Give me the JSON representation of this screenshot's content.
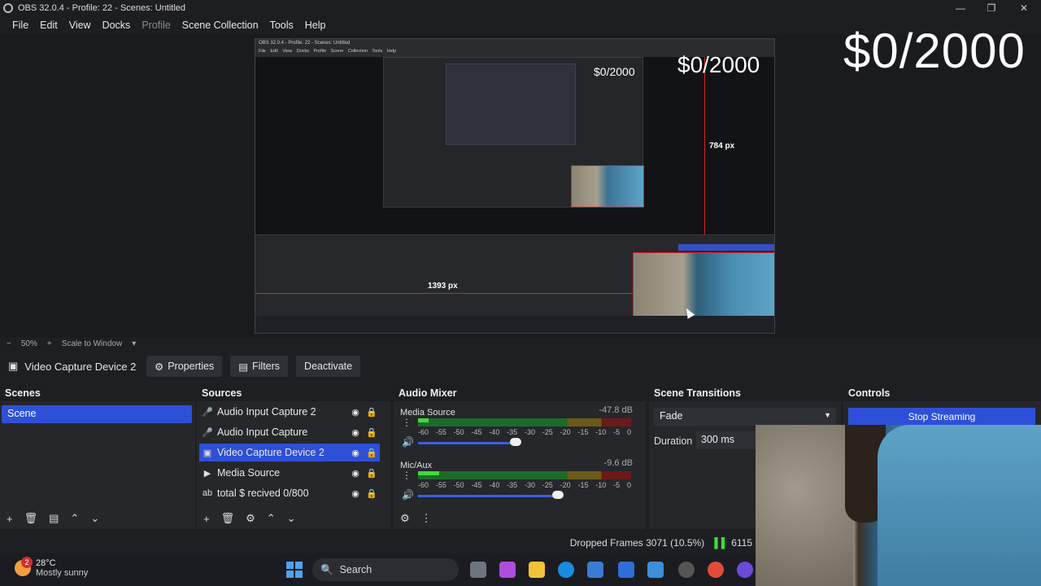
{
  "window": {
    "title": "OBS 32.0.4 - Profile: 22 - Scenes: Untitled"
  },
  "menu": [
    "File",
    "Edit",
    "View",
    "Docks",
    "Profile",
    "Scene Collection",
    "Tools",
    "Help"
  ],
  "overlay": {
    "goal_text": "$0/2000"
  },
  "nested_preview": {
    "title": "OBS 32.0.4 - Profile: 22 - Scenes: Untitled",
    "menu": "File Edit View Docks Profile Scene Collection Tools Help",
    "goal_text": "$0/2000",
    "goal_text_small": "$0/2000",
    "height_label": "784 px",
    "width_label": "1393 px"
  },
  "zoom": {
    "level": "50%",
    "mode": "Scale to Window"
  },
  "source_bar": {
    "selected_source": "Video Capture Device 2",
    "properties": "Properties",
    "filters": "Filters",
    "deactivate": "Deactivate"
  },
  "scenes": {
    "header": "Scenes",
    "items": [
      "Scene"
    ]
  },
  "sources": {
    "header": "Sources",
    "items": [
      {
        "label": "Audio Input Capture 2",
        "icon": "mic-icon"
      },
      {
        "label": "Audio Input Capture",
        "icon": "mic-icon"
      },
      {
        "label": "Video Capture Device 2",
        "icon": "camera-icon",
        "selected": true
      },
      {
        "label": "Media Source",
        "icon": "play-icon"
      },
      {
        "label": "total $ recived 0/800",
        "icon": "text-icon"
      }
    ]
  },
  "audio_mixer": {
    "header": "Audio Mixer",
    "channels": [
      {
        "name": "Media Source",
        "db": "-47.8 dB",
        "level": 0.05,
        "volume": 0.6
      },
      {
        "name": "Mic/Aux",
        "db": "-9.6 dB",
        "level": 0.1,
        "volume": 0.86
      }
    ],
    "scale": [
      "-60",
      "-55",
      "-50",
      "-45",
      "-40",
      "-35",
      "-30",
      "-25",
      "-20",
      "-15",
      "-10",
      "-5",
      "0"
    ]
  },
  "scene_transitions": {
    "header": "Scene Transitions",
    "transition": "Fade",
    "duration_label": "Duration",
    "duration_value": "300 ms"
  },
  "controls": {
    "header": "Controls",
    "stop_streaming": "Stop Streaming"
  },
  "status": {
    "dropped_frames": "Dropped Frames 3071 (10.5%)",
    "bitrate": "6115"
  },
  "taskbar": {
    "temperature": "28°C",
    "weather": "Mostly sunny",
    "badge": "2",
    "search": "Search"
  }
}
